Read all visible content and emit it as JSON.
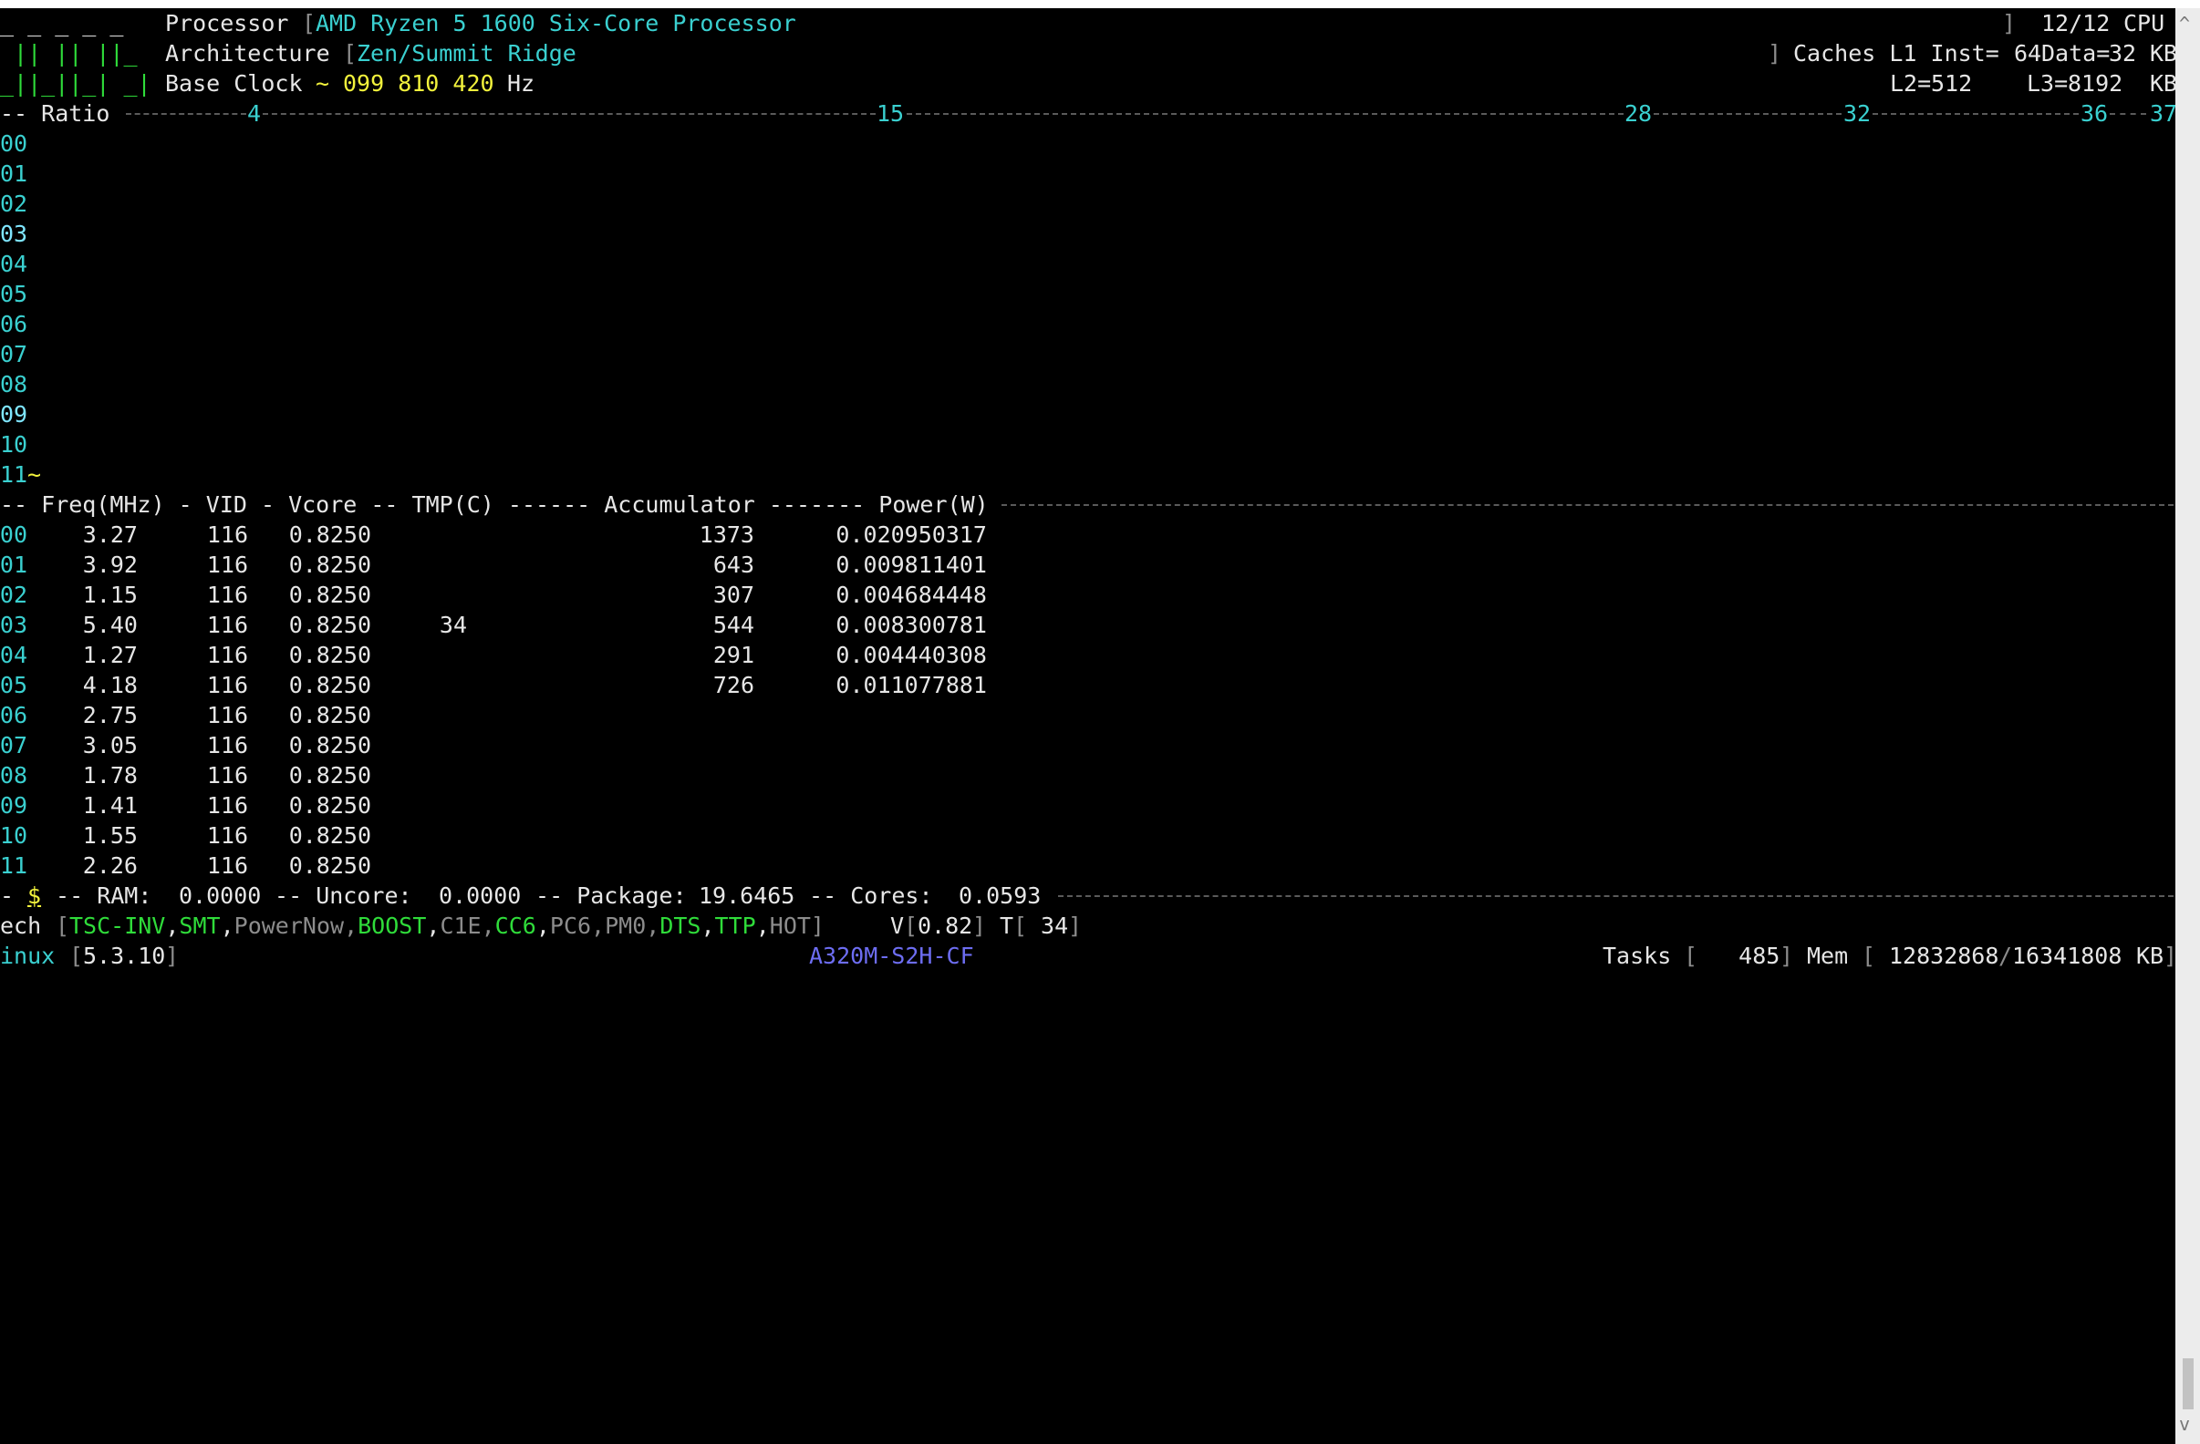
{
  "header": {
    "logo": [
      "_ _ _ _ _",
      " || || ||_",
      "_||_||_| _|"
    ],
    "processor_label": "Processor",
    "processor_name": "AMD Ryzen 5 1600 Six-Core Processor",
    "architecture_label": "Architecture",
    "architecture_name": "Zen/Summit Ridge",
    "base_clock_label": "Base Clock",
    "base_clock_value": "099 810 420",
    "base_clock_unit": "Hz",
    "cpu_count": "12/12",
    "cpu_label": "CPU",
    "caches_label": "Caches L1 Inst=",
    "l1_inst": "64",
    "l1_data_label": "Data=",
    "l1_data": "32",
    "kb": "KB",
    "l2_label": "L2=",
    "l2": "512",
    "l3_label": "L3=",
    "l3": "8192"
  },
  "ratio": {
    "label": "-- Ratio ",
    "marks": [
      "4",
      "15",
      "28",
      "32",
      "36",
      "37"
    ],
    "cores": [
      "00",
      "01",
      "02",
      "03",
      "04",
      "05",
      "06",
      "07",
      "08",
      "09",
      "10",
      "11"
    ],
    "last_marker": "~"
  },
  "table": {
    "header": "-- Freq(MHz) - VID - Vcore -- TMP(C) ------ Accumulator ------- Power(W) ",
    "rows": [
      {
        "core": "00",
        "freq": "3.27",
        "vid": "116",
        "vcore": "0.8250",
        "tmp": "",
        "acc": "1373",
        "power": "0.020950317"
      },
      {
        "core": "01",
        "freq": "3.92",
        "vid": "116",
        "vcore": "0.8250",
        "tmp": "",
        "acc": "643",
        "power": "0.009811401"
      },
      {
        "core": "02",
        "freq": "1.15",
        "vid": "116",
        "vcore": "0.8250",
        "tmp": "",
        "acc": "307",
        "power": "0.004684448"
      },
      {
        "core": "03",
        "freq": "5.40",
        "vid": "116",
        "vcore": "0.8250",
        "tmp": "34",
        "acc": "544",
        "power": "0.008300781"
      },
      {
        "core": "04",
        "freq": "1.27",
        "vid": "116",
        "vcore": "0.8250",
        "tmp": "",
        "acc": "291",
        "power": "0.004440308"
      },
      {
        "core": "05",
        "freq": "4.18",
        "vid": "116",
        "vcore": "0.8250",
        "tmp": "",
        "acc": "726",
        "power": "0.011077881"
      },
      {
        "core": "06",
        "freq": "2.75",
        "vid": "116",
        "vcore": "0.8250",
        "tmp": "",
        "acc": "",
        "power": ""
      },
      {
        "core": "07",
        "freq": "3.05",
        "vid": "116",
        "vcore": "0.8250",
        "tmp": "",
        "acc": "",
        "power": ""
      },
      {
        "core": "08",
        "freq": "1.78",
        "vid": "116",
        "vcore": "0.8250",
        "tmp": "",
        "acc": "",
        "power": ""
      },
      {
        "core": "09",
        "freq": "1.41",
        "vid": "116",
        "vcore": "0.8250",
        "tmp": "",
        "acc": "",
        "power": ""
      },
      {
        "core": "10",
        "freq": "1.55",
        "vid": "116",
        "vcore": "0.8250",
        "tmp": "",
        "acc": "",
        "power": ""
      },
      {
        "core": "11",
        "freq": "2.26",
        "vid": "116",
        "vcore": "0.8250",
        "tmp": "",
        "acc": "",
        "power": ""
      }
    ]
  },
  "energy": {
    "prefix": "- ",
    "unit_symbol": "$",
    "ram_label": " -- RAM: ",
    "ram": "0.0000",
    "uncore_label": " -- Uncore: ",
    "uncore": "0.0000",
    "package_label": " -- Package: ",
    "package": "19.6465",
    "cores_label": " -- Cores: ",
    "cores": "0.0593"
  },
  "tech": {
    "label": "ech",
    "flags": [
      {
        "name": "TSC-INV",
        "on": true
      },
      {
        "name": "SMT",
        "on": true
      },
      {
        "name": "PowerNow",
        "on": false
      },
      {
        "name": "BOOST",
        "on": true
      },
      {
        "name": "C1E",
        "on": false
      },
      {
        "name": "CC6",
        "on": true
      },
      {
        "name": "PC6",
        "on": false
      },
      {
        "name": "PM0",
        "on": false
      },
      {
        "name": "DTS",
        "on": true
      },
      {
        "name": "TTP",
        "on": true
      },
      {
        "name": "HOT",
        "on": false
      }
    ],
    "voltage_label": "V",
    "voltage": "0.82",
    "temp_label": "T",
    "temp": " 34",
    "on_color": "#2fdc3a",
    "off_color": "#8c8c8c"
  },
  "system": {
    "os_label": "inux",
    "kernel": "5.3.10",
    "board": "A320M-S2H-CF",
    "tasks_label": "Tasks",
    "tasks": "   485",
    "mem_label": "Mem",
    "mem_used": "12832868",
    "mem_total": "16341808",
    "mem_unit": "KB"
  }
}
